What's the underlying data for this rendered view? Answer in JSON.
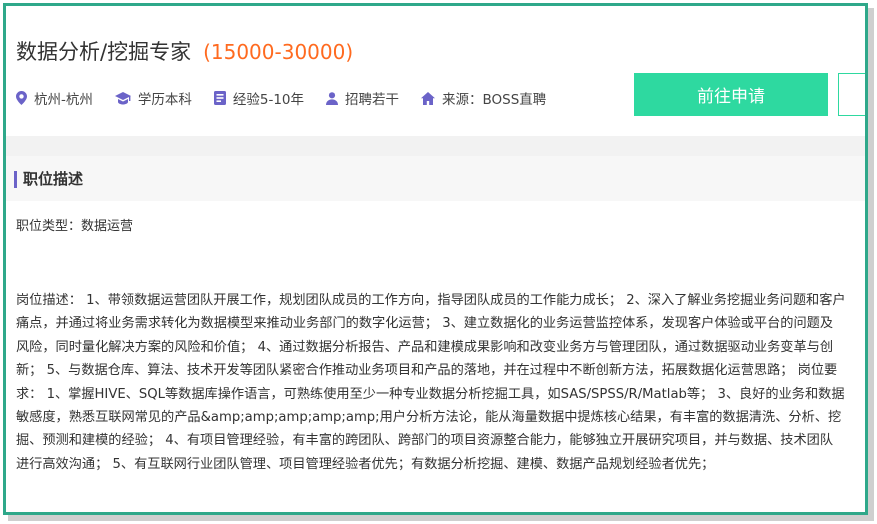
{
  "job": {
    "title": "数据分析/挖掘专家",
    "salary": "(15000-30000)"
  },
  "meta": {
    "location": "杭州-杭州",
    "education": "学历本科",
    "experience": "经验5-10年",
    "headcount": "招聘若干",
    "source": "来源：BOSS直聘"
  },
  "actions": {
    "apply_label": "前往申请"
  },
  "section": {
    "title": "职位描述"
  },
  "content": {
    "job_type": "职位类型：数据运营",
    "description": "岗位描述： 1、带领数据运营团队开展工作，规划团队成员的工作方向，指导团队成员的工作能力成长； 2、深入了解业务挖掘业务问题和客户痛点，并通过将业务需求转化为数据模型来推动业务部门的数字化运营； 3、建立数据化的业务运营监控体系，发现客户体验或平台的问题及风险，同时量化解决方案的风险和价值； 4、通过数据分析报告、产品和建模成果影响和改变业务方与管理团队，通过数据驱动业务变革与创新； 5、与数据仓库、算法、技术开发等团队紧密合作推动业务项目和产品的落地，并在过程中不断创新方法，拓展数据化运营思路； 岗位要求： 1、掌握HIVE、SQL等数据库操作语言，可熟练使用至少一种专业数据分析挖掘工具，如SAS/SPSS/R/Matlab等； 3、良好的业务和数据敏感度，熟悉互联网常见的产品&amp;amp;amp;amp;amp;用户分析方法论，能从海量数据中提炼核心结果，有丰富的数据清洗、分析、挖掘、预测和建模的经验； 4、有项目管理经验，有丰富的跨团队、跨部门的项目资源整合能力，能够独立开展研究项目，并与数据、技术团队进行高效沟通； 5、有互联网行业团队管理、项目管理经验者优先；有数据分析挖掘、建模、数据产品规划经验者优先；"
  },
  "colors": {
    "border": "#2fa88a",
    "salary": "#ff6a1f",
    "button": "#2ed9a0",
    "icon": "#6b63c8"
  }
}
